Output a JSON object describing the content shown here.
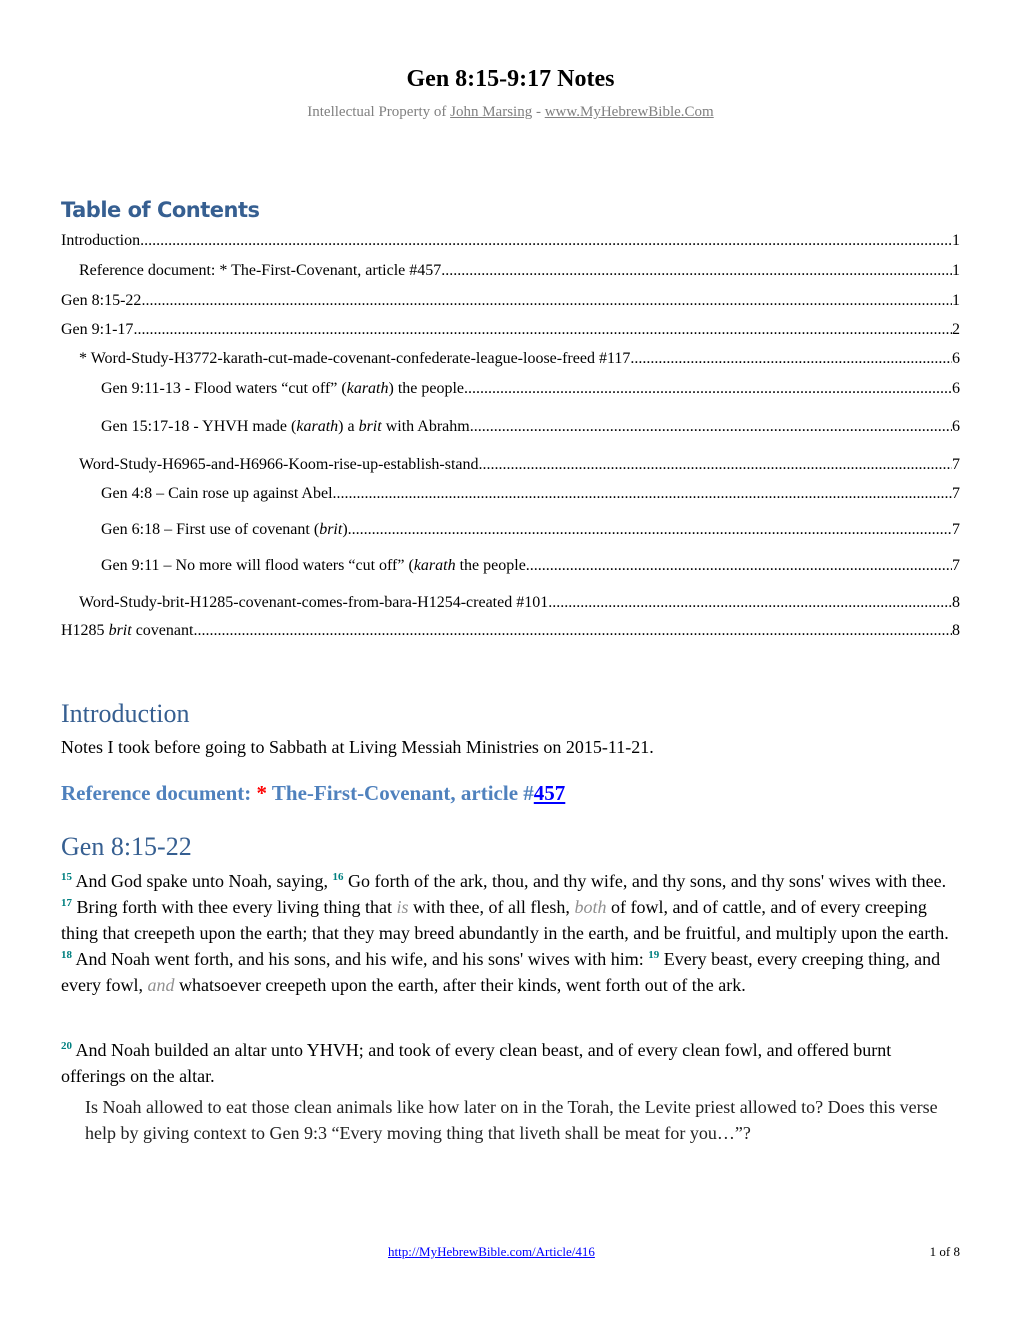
{
  "document": {
    "title": "Gen 8:15-9:17 Notes",
    "subtitle_prefix": "Intellectual Property of ",
    "author_link": "John Marsing",
    "subtitle_separator": " - ",
    "site_link": "www.MyHebrewBible.Com"
  },
  "toc": {
    "heading": "Table of Contents",
    "entries": [
      {
        "level": 1,
        "parts": [
          {
            "text": "Introduction"
          }
        ],
        "page": "1"
      },
      {
        "level": 2,
        "parts": [
          {
            "text": "Reference document: * The-First-Covenant, article #457"
          }
        ],
        "page": "1"
      },
      {
        "level": 1,
        "parts": [
          {
            "text": "Gen 8:15-22"
          }
        ],
        "page": "1"
      },
      {
        "level": 1,
        "parts": [
          {
            "text": "Gen 9:1-17"
          }
        ],
        "page": "2"
      },
      {
        "level": 2,
        "parts": [
          {
            "text": "* Word-Study-H3772-karath-cut-made-covenant-confederate-league-loose-freed #117"
          }
        ],
        "page": "6"
      },
      {
        "level": 3,
        "parts": [
          {
            "text": "Gen 9:11-13  - Flood waters “cut off” ("
          },
          {
            "text": "karath",
            "italic": true
          },
          {
            "text": ") the people"
          }
        ],
        "page": "6"
      },
      {
        "level": 3,
        "parts": [
          {
            "text": "Gen 15:17-18  - YHVH made ("
          },
          {
            "text": "karath",
            "italic": true
          },
          {
            "text": ") a "
          },
          {
            "text": "brit",
            "italic": true
          },
          {
            "text": " with Abrahm"
          }
        ],
        "page": "6"
      },
      {
        "level": 2,
        "parts": [
          {
            "text": "Word-Study-H6965-and-H6966-Koom-rise-up-establish-stand"
          }
        ],
        "page": "7"
      },
      {
        "level": 3,
        "parts": [
          {
            "text": "Gen 4:8 – Cain rose up against Abel"
          }
        ],
        "page": "7"
      },
      {
        "level": 3,
        "parts": [
          {
            "text": "Gen 6:18 – First use of covenant ("
          },
          {
            "text": "brit",
            "italic": true
          },
          {
            "text": ")"
          }
        ],
        "page": "7"
      },
      {
        "level": 3,
        "parts": [
          {
            "text": "Gen 9:11 – No more will flood waters “cut off” ("
          },
          {
            "text": "karath",
            "italic": true
          },
          {
            "text": " the people"
          }
        ],
        "page": "7"
      },
      {
        "level": 2,
        "parts": [
          {
            "text": "Word-Study-brit-H1285-covenant-comes-from-bara-H1254-created #101"
          }
        ],
        "page": "8"
      },
      {
        "level": 1,
        "parts": [
          {
            "text": "H1285 "
          },
          {
            "text": "brit",
            "italic": true
          },
          {
            "text": " covenant"
          }
        ],
        "page": "8"
      }
    ]
  },
  "introduction": {
    "heading": "Introduction",
    "text": "Notes I took before going to Sabbath at Living Messiah Ministries on 2015-11-21.",
    "reference_heading_prefix": "Reference document: ",
    "reference_star": "*",
    "reference_heading_middle": " The-First-Covenant, article #",
    "reference_link": "457"
  },
  "gen8": {
    "heading": "Gen 8:15-22",
    "paragraph1": [
      {
        "verse": "15"
      },
      {
        "text": " And God spake unto Noah, saying,  "
      },
      {
        "verse": "16"
      },
      {
        "text": " Go forth of the ark, thou, and thy wife, and thy sons, and thy sons' wives with thee.  "
      },
      {
        "verse": "17"
      },
      {
        "text": " Bring forth with thee every living thing that "
      },
      {
        "added": "is"
      },
      {
        "text": " with thee, of all flesh, "
      },
      {
        "added": "both"
      },
      {
        "text": " of fowl, and of cattle, and of every creeping thing that creepeth upon the earth; that they may breed abundantly in the earth, and be fruitful, and multiply upon the earth.  "
      },
      {
        "verse": "18"
      },
      {
        "text": " And Noah went forth, and his sons, and his wife, and his sons' wives with him:  "
      },
      {
        "verse": "19"
      },
      {
        "text": " Every beast, every creeping thing, and every fowl, "
      },
      {
        "added": "and"
      },
      {
        "text": " whatsoever creepeth upon the earth, after their kinds, went forth out of the ark."
      }
    ],
    "paragraph2": [
      {
        "verse": "20"
      },
      {
        "text": " And Noah builded an altar unto YHVH; and took of every clean beast, and of every clean fowl, and offered burnt offerings on the altar."
      }
    ],
    "note": "Is Noah allowed to eat those clean animals like how later on in the Torah, the Levite priest allowed to?  Does this verse help by giving context to Gen 9:3 “Every moving thing that liveth shall be meat for you…”?"
  },
  "footer": {
    "url": "http://MyHebrewBible.com/Article/416",
    "page_indicator": "1 of 8"
  },
  "colors": {
    "heading_dark_blue": "#365f91",
    "heading_light_blue": "#4f81bd",
    "verse_number": "#008080",
    "added_word": "#909090",
    "link": "#0000ff",
    "star": "#ff0000",
    "subtitle_gray": "#808080"
  }
}
